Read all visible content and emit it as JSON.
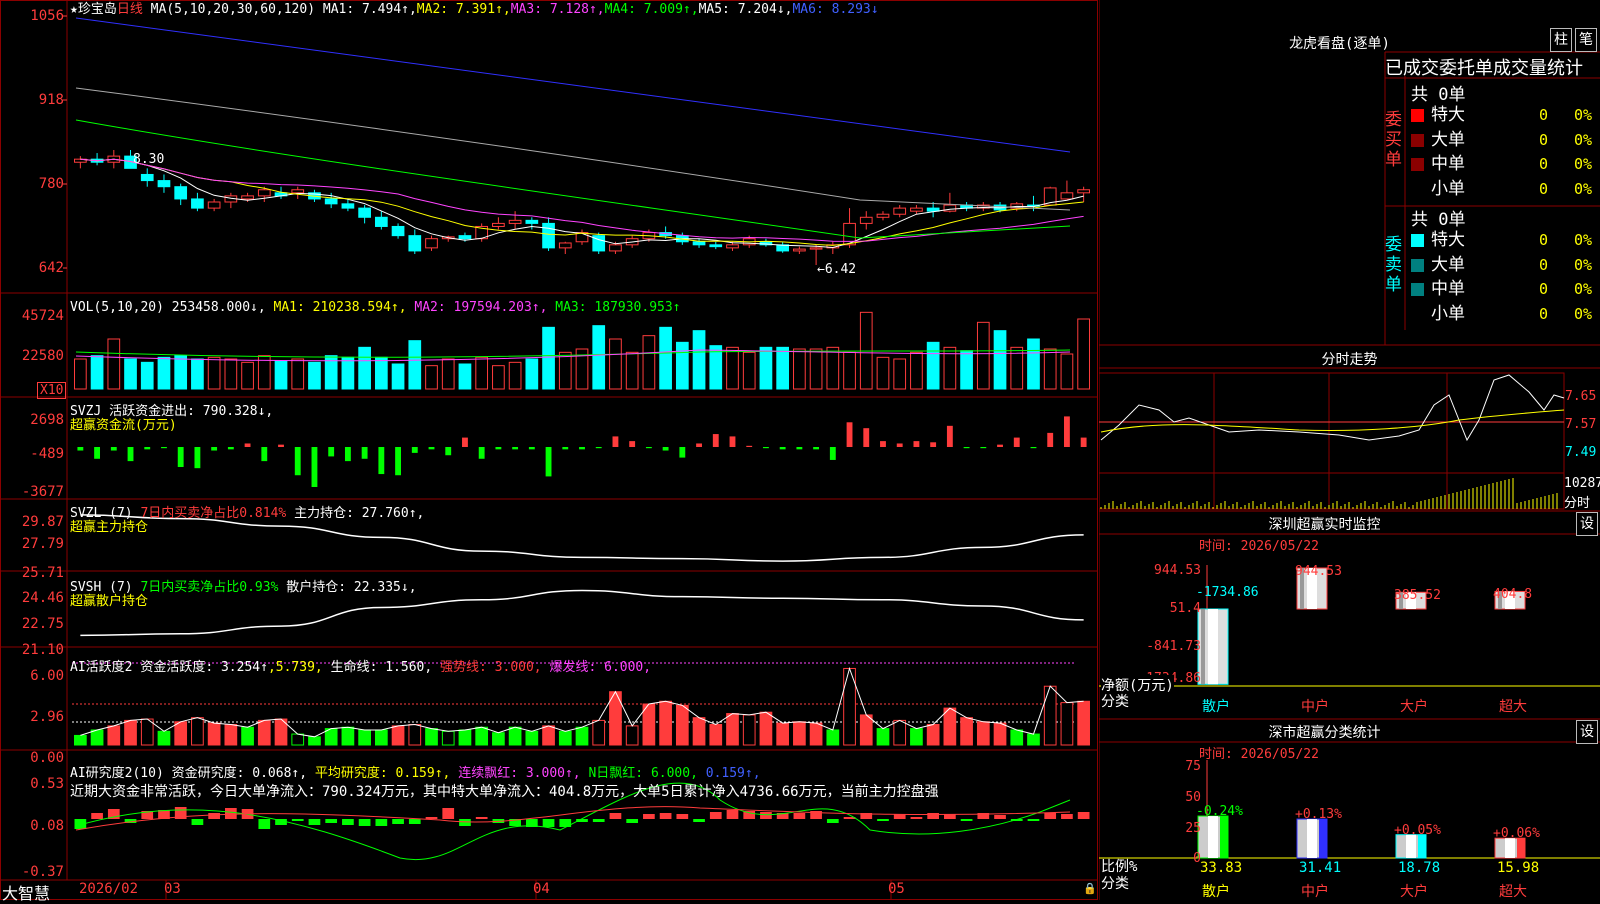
{
  "main": {
    "stock_title": "★珍宝岛",
    "period": "日线",
    "k_header": {
      "ma_label": "MA(5,10,20,30,60,120)",
      "ma1": "MA1: 7.494↑,",
      "ma2": "MA2: 7.391↑,",
      "ma3": "MA3: 7.128↑,",
      "ma4": "MA4: 7.009↑,",
      "ma5": "MA5: 7.204↓,",
      "ma6": "MA6: 8.293↓"
    },
    "k_axis": [
      "1056",
      "918",
      "780",
      "642"
    ],
    "k_annot_high": "8.30",
    "k_annot_low": "←6.42",
    "vol_header": {
      "label": "VOL(5,10,20)",
      "value": "253458.000↓,",
      "ma1": "MA1: 210238.594↑,",
      "ma2": "MA2: 197594.203↑,",
      "ma3": "MA3: 187930.953↑"
    },
    "vol_axis": [
      "45724",
      "22580"
    ],
    "vol_unit": "X10",
    "svzj_header": {
      "label": "SVZJ",
      "text": "活跃资金进出: 790.328↓,",
      "sub": "超赢资金流(万元)"
    },
    "svzj_axis": [
      "2698",
      "-489",
      "-3677"
    ],
    "svzl_header": {
      "label": "SVZL (7)",
      "ratio": "7日内买卖净占比0.814%",
      "text": "主力持仓: 27.760↑,",
      "sub": "超赢主力持仓"
    },
    "svzl_axis": [
      "29.87",
      "27.79",
      "25.71"
    ],
    "svsh_header": {
      "label": "SVSH (7)",
      "ratio": "7日内买卖净占比0.93%",
      "text": "散户持仓: 22.335↓,",
      "sub": "超赢散户持仓"
    },
    "svsh_axis": [
      "24.46",
      "22.75",
      "21.10"
    ],
    "ai1_header": {
      "label": "AI活跃度2",
      "text": "资金活跃度: 3.254↑",
      "v2": ",5.739,",
      "life": "生命线: 1.560,",
      "strong": "强势线: 3.000,",
      "burst": "爆发线: 6.000,"
    },
    "ai1_axis": [
      "6.00",
      "2.96",
      "0.00"
    ],
    "ai2_header": {
      "label": "AI研究度2(10)",
      "text": "资金研究度: 0.068↑,",
      "avg": "平均研究度: 0.159↑,",
      "cont": "连续飘红: 3.000↑,",
      "nday": "N日飘红: 6.000,",
      "v5": "0.159↑,"
    },
    "ai2_comment": "近期大资金非常活跃，今日大单净流入：790.324万元，其中特大单净流入：404.8万元，大单5日累计净入4736.66万元，当前主力控盘强",
    "ai2_axis": [
      "0.53",
      "0.08",
      "-0.37"
    ],
    "x_axis": {
      "brand": "大智慧",
      "d1": "2026/02",
      "d2": "03",
      "d3": "04",
      "d4": "05"
    }
  },
  "chart_data": [
    {
      "type": "candlestick",
      "title": "★珍宝岛 日线",
      "ylim": [
        6.42,
        10.56
      ],
      "ticks": [
        "1056",
        "918",
        "780",
        "642"
      ],
      "ohlc": [
        [
          8.1,
          8.2,
          8.0,
          8.15
        ],
        [
          8.15,
          8.25,
          8.05,
          8.1
        ],
        [
          8.1,
          8.3,
          8.0,
          8.2
        ],
        [
          8.2,
          8.3,
          8.0,
          8.0
        ],
        [
          7.9,
          8.0,
          7.7,
          7.8
        ],
        [
          7.8,
          7.9,
          7.6,
          7.7
        ],
        [
          7.7,
          7.75,
          7.4,
          7.5
        ],
        [
          7.5,
          7.6,
          7.3,
          7.35
        ],
        [
          7.35,
          7.5,
          7.3,
          7.45
        ],
        [
          7.45,
          7.6,
          7.35,
          7.55
        ],
        [
          7.5,
          7.6,
          7.45,
          7.55
        ],
        [
          7.55,
          7.7,
          7.45,
          7.65
        ],
        [
          7.6,
          7.7,
          7.5,
          7.55
        ],
        [
          7.6,
          7.7,
          7.5,
          7.65
        ],
        [
          7.6,
          7.65,
          7.45,
          7.5
        ],
        [
          7.5,
          7.6,
          7.35,
          7.42
        ],
        [
          7.42,
          7.5,
          7.3,
          7.35
        ],
        [
          7.35,
          7.4,
          7.1,
          7.2
        ],
        [
          7.2,
          7.3,
          7.0,
          7.05
        ],
        [
          7.05,
          7.1,
          6.85,
          6.9
        ],
        [
          6.9,
          7.0,
          6.6,
          6.65
        ],
        [
          6.7,
          6.9,
          6.65,
          6.85
        ],
        [
          6.85,
          6.9,
          6.8,
          6.88
        ],
        [
          6.9,
          6.95,
          6.8,
          6.85
        ],
        [
          6.85,
          7.1,
          6.8,
          7.05
        ],
        [
          7.05,
          7.2,
          7.0,
          7.1
        ],
        [
          7.1,
          7.3,
          7.0,
          7.15
        ],
        [
          7.15,
          7.2,
          7.0,
          7.1
        ],
        [
          7.1,
          7.2,
          6.65,
          6.7
        ],
        [
          6.7,
          6.8,
          6.6,
          6.78
        ],
        [
          6.8,
          7.0,
          6.75,
          6.95
        ],
        [
          6.9,
          6.95,
          6.6,
          6.65
        ],
        [
          6.65,
          6.8,
          6.6,
          6.75
        ],
        [
          6.75,
          6.9,
          6.7,
          6.85
        ],
        [
          6.85,
          7.0,
          6.8,
          6.95
        ],
        [
          6.95,
          7.05,
          6.85,
          6.9
        ],
        [
          6.9,
          6.95,
          6.75,
          6.8
        ],
        [
          6.8,
          6.85,
          6.7,
          6.75
        ],
        [
          6.75,
          6.8,
          6.68,
          6.72
        ],
        [
          6.7,
          6.8,
          6.65,
          6.75
        ],
        [
          6.75,
          6.9,
          6.7,
          6.85
        ],
        [
          6.8,
          6.85,
          6.72,
          6.75
        ],
        [
          6.75,
          6.8,
          6.62,
          6.65
        ],
        [
          6.65,
          6.72,
          6.6,
          6.68
        ],
        [
          6.68,
          6.75,
          6.42,
          6.7
        ],
        [
          6.7,
          6.8,
          6.6,
          6.75
        ],
        [
          6.75,
          7.35,
          6.7,
          7.1
        ],
        [
          7.1,
          7.3,
          7.0,
          7.2
        ],
        [
          7.2,
          7.3,
          7.15,
          7.25
        ],
        [
          7.25,
          7.4,
          7.2,
          7.35
        ],
        [
          7.3,
          7.4,
          7.25,
          7.35
        ],
        [
          7.35,
          7.45,
          7.2,
          7.3
        ],
        [
          7.3,
          7.6,
          7.28,
          7.4
        ],
        [
          7.4,
          7.45,
          7.3,
          7.35
        ],
        [
          7.35,
          7.45,
          7.3,
          7.4
        ],
        [
          7.4,
          7.45,
          7.28,
          7.32
        ],
        [
          7.35,
          7.45,
          7.3,
          7.42
        ],
        [
          7.4,
          7.55,
          7.3,
          7.38
        ],
        [
          7.4,
          7.7,
          7.4,
          7.68
        ],
        [
          7.5,
          7.8,
          7.5,
          7.6
        ],
        [
          7.6,
          7.7,
          7.45,
          7.65
        ]
      ]
    },
    {
      "type": "bar",
      "title": "VOL(5,10,20)",
      "ticks": [
        "45724",
        "22580"
      ],
      "values": [
        18,
        20,
        30,
        18,
        16,
        19,
        20,
        18,
        19,
        18,
        16,
        20,
        17,
        18,
        16,
        20,
        19,
        25,
        19,
        15,
        29,
        14,
        18,
        15,
        19,
        14,
        16,
        18,
        37,
        22,
        24,
        38,
        30,
        22,
        32,
        37,
        28,
        35,
        26,
        25,
        22,
        25,
        25,
        24,
        24,
        25,
        22,
        46,
        19,
        18,
        22,
        28,
        25,
        23,
        40,
        35,
        25,
        30,
        24,
        21,
        42
      ]
    },
    {
      "type": "bar",
      "title": "SVZJ 超赢资金流(万元)",
      "ticks": [
        "2698",
        "-489",
        "-3677"
      ],
      "values": [
        -300,
        -1000,
        -300,
        -1200,
        -200,
        -100,
        -1700,
        -1800,
        -300,
        -200,
        300,
        -1200,
        200,
        -2400,
        -3400,
        -800,
        -1200,
        -1000,
        -2300,
        -2400,
        -500,
        -200,
        -700,
        800,
        -1000,
        -200,
        -200,
        -200,
        -2500,
        -200,
        -200,
        -100,
        900,
        500,
        -100,
        -300,
        -900,
        300,
        1100,
        900,
        100,
        -100,
        -200,
        -200,
        -200,
        -1100,
        2100,
        1600,
        500,
        300,
        500,
        400,
        1800,
        -100,
        -100,
        200,
        800,
        -100,
        1200,
        2600,
        800
      ]
    },
    {
      "type": "line",
      "title": "SVZL 超赢主力持仓",
      "ticks": [
        "29.87",
        "27.79",
        "25.71"
      ],
      "x": [
        0,
        6,
        12,
        18,
        24,
        30,
        36,
        42,
        48,
        54,
        60
      ],
      "values": [
        29.8,
        29.5,
        28.9,
        28.0,
        26.9,
        26.4,
        26.3,
        26.1,
        26.4,
        27.2,
        28.2
      ]
    },
    {
      "type": "line",
      "title": "SVSH 超赢散户持仓",
      "ticks": [
        "24.46",
        "22.75",
        "21.10"
      ],
      "x": [
        0,
        6,
        12,
        18,
        24,
        30,
        36,
        42,
        48,
        54,
        60
      ],
      "values": [
        21.4,
        21.5,
        22.0,
        23.2,
        23.7,
        24.3,
        23.9,
        23.8,
        23.7,
        23.3,
        22.4
      ]
    },
    {
      "type": "bar",
      "title": "AI活跃度2",
      "ticks": [
        "6.00",
        "2.96",
        "0.00"
      ],
      "values": [
        0.7,
        1.1,
        1.4,
        1.8,
        1.9,
        1.0,
        1.7,
        2.0,
        1.6,
        1.5,
        1.3,
        1.8,
        1.9,
        0.8,
        0.6,
        1.2,
        1.3,
        1.1,
        1.1,
        1.4,
        1.5,
        1.2,
        1.0,
        1.1,
        1.3,
        0.9,
        1.3,
        1.0,
        1.4,
        1.0,
        1.3,
        1.8,
        3.9,
        1.4,
        3.0,
        3.2,
        2.9,
        2.0,
        1.5,
        2.3,
        2.2,
        2.4,
        1.6,
        1.7,
        1.6,
        1.1,
        5.6,
        2.2,
        1.2,
        1.8,
        1.2,
        1.5,
        2.7,
        2.0,
        1.7,
        1.6,
        1.1,
        0.8,
        4.3,
        3.1,
        3.2
      ]
    },
    {
      "type": "bar",
      "title": "AI研究度2(10)",
      "ticks": [
        "0.53",
        "0.08",
        "-0.37"
      ],
      "values": [
        -0.1,
        0.06,
        0.1,
        -0.04,
        0.08,
        0.09,
        0.12,
        -0.06,
        0.06,
        0.11,
        0.1,
        -0.1,
        -0.06,
        -0.02,
        -0.06,
        -0.04,
        -0.06,
        -0.07,
        -0.07,
        -0.05,
        -0.05,
        0.02,
        0.11,
        -0.07,
        0.02,
        -0.04,
        -0.07,
        -0.08,
        -0.08,
        -0.08,
        -0.03,
        -0.03,
        0.06,
        -0.04,
        0.05,
        0.06,
        0.05,
        -0.03,
        0.07,
        0.09,
        0.08,
        0.07,
        0.06,
        0.06,
        0.08,
        -0.04,
        0.02,
        0.06,
        -0.02,
        0.05,
        0.02,
        0.06,
        0.05,
        -0.02,
        0.06,
        0.04,
        -0.02,
        -0.02,
        0.06,
        0.05,
        0.07
      ]
    }
  ],
  "right": {
    "lhb": {
      "title": "龙虎看盘(逐单)",
      "btn1": "柱",
      "btn2": "笔",
      "subtitle": "已成交委托单成交量统计",
      "buy_label": "委买单",
      "sell_label": "委卖单",
      "buy_total": "共 0单",
      "sell_total": "共 0单",
      "buy_rows": [
        {
          "name": "特大",
          "count": "0",
          "pct": "0%",
          "color": "#ff0000"
        },
        {
          "name": "大单",
          "count": "0",
          "pct": "0%",
          "color": "#8b0000"
        },
        {
          "name": "中单",
          "count": "0",
          "pct": "0%",
          "color": "#8b0000"
        },
        {
          "name": "小单",
          "count": "0",
          "pct": "0%",
          "color": "#000000"
        }
      ],
      "sell_rows": [
        {
          "name": "特大",
          "count": "0",
          "pct": "0%",
          "color": "#00ffff"
        },
        {
          "name": "大单",
          "count": "0",
          "pct": "0%",
          "color": "#008080"
        },
        {
          "name": "中单",
          "count": "0",
          "pct": "0%",
          "color": "#008080"
        },
        {
          "name": "小单",
          "count": "0",
          "pct": "0%",
          "color": "#000000"
        }
      ]
    },
    "fs": {
      "title": "分时走势",
      "prices": [
        "7.65",
        "7.57",
        "7.49"
      ],
      "vol_label": "10287",
      "vol_unit": "分时"
    },
    "monitor": {
      "title": "深圳超赢实时监控",
      "btn": "设",
      "time": "时间: 2026/05/22",
      "axis": [
        "944.53",
        "51.4",
        "-841.73",
        "-1734.86"
      ],
      "ylabel1": "净额(万元)",
      "ylabel2": "分类",
      "categories": [
        "散户",
        "中户",
        "大户",
        "超大"
      ],
      "values": [
        -1734.86,
        944.53,
        385.52,
        404.8
      ],
      "labels": [
        "-1734.86",
        "944.53",
        "385.52",
        "404.8"
      ]
    },
    "stat": {
      "title": "深市超赢分类统计",
      "btn": "设",
      "time": "时间: 2026/05/22",
      "axis": [
        "75",
        "50",
        "25",
        "0"
      ],
      "ylabel1": "比例%",
      "ylabel2": "分类",
      "categories": [
        "散户",
        "中户",
        "大户",
        "超大"
      ],
      "ratios": [
        "33.83",
        "31.41",
        "18.78",
        "15.98"
      ],
      "changes": [
        "-0.24%",
        "+0.13%",
        "+0.05%",
        "+0.06%"
      ],
      "ratio_values": [
        33.83,
        31.41,
        18.78,
        15.98
      ]
    }
  }
}
